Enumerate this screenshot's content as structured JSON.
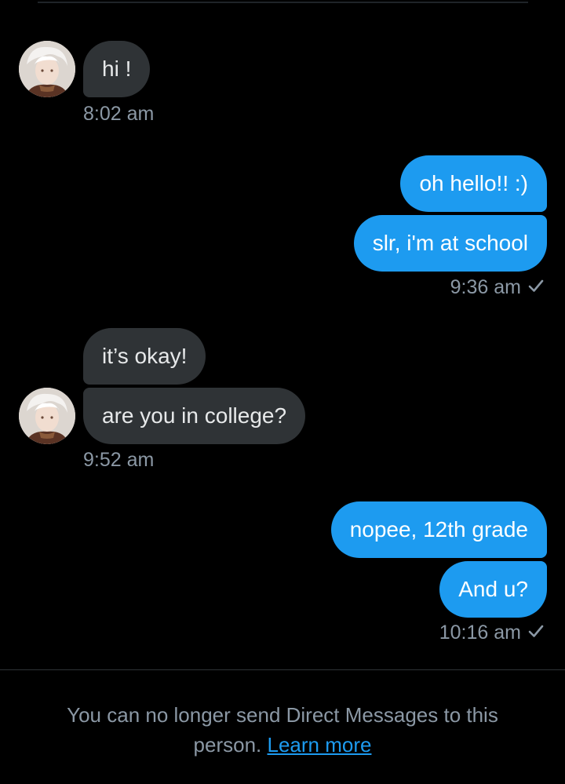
{
  "colors": {
    "background": "#000000",
    "incoming_bubble": "#2f3336",
    "outgoing_bubble": "#1d9bf0",
    "timestamp": "#8b98a5",
    "link": "#1d9bf0"
  },
  "messages": [
    {
      "direction": "incoming",
      "text": "hi !"
    },
    {
      "direction": "outgoing",
      "text": "oh hello!! :)"
    },
    {
      "direction": "outgoing",
      "text": "slr, i'm at school"
    },
    {
      "direction": "incoming",
      "text": "it’s okay!"
    },
    {
      "direction": "incoming",
      "text": "are you in college?"
    },
    {
      "direction": "outgoing",
      "text": "nopee, 12th grade"
    },
    {
      "direction": "outgoing",
      "text": "And u?"
    }
  ],
  "timestamps": [
    "8:02 am",
    "9:36 am",
    "9:52 am",
    "10:16 am"
  ],
  "icons": {
    "avatar": "user-avatar",
    "sent_status": "checkmark-icon"
  },
  "footer": {
    "notice_text": "You can no longer send Direct Messages to this person.",
    "link_label": "Learn more"
  }
}
